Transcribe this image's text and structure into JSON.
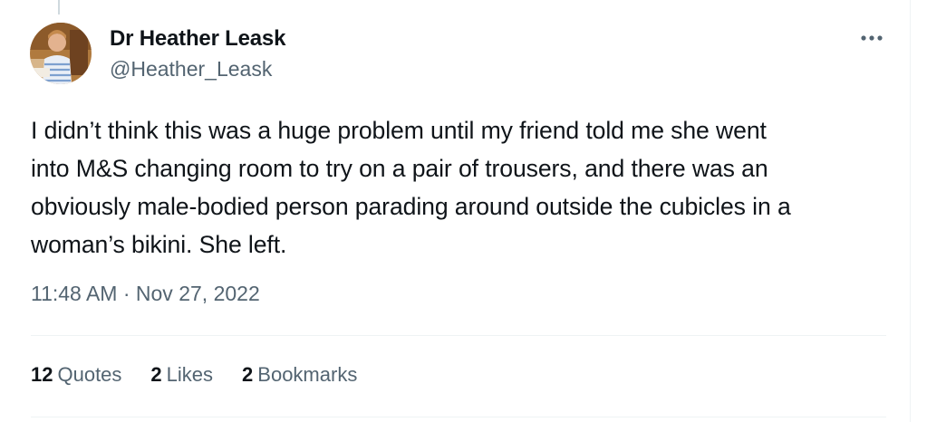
{
  "tweet": {
    "author_name": "Dr Heather Leask",
    "author_handle": "@Heather_Leask",
    "text": "I didn’t think this was a huge problem until my friend told me she went\ninto M&S changing room to try on a pair of trousers, and there was an\nobviously male-bodied person parading around outside the cubicles in a\nwoman’s bikini. She left.",
    "timestamp": "11:48 AM · Nov 27, 2022",
    "more_icon": "more-horizontal-icon"
  },
  "stats": [
    {
      "count": "12",
      "label": "Quotes"
    },
    {
      "count": "2",
      "label": "Likes"
    },
    {
      "count": "2",
      "label": "Bookmarks"
    }
  ],
  "colors": {
    "text_primary": "#0f1419",
    "text_secondary": "#536471",
    "divider": "#eff3f4",
    "background": "#ffffff"
  }
}
